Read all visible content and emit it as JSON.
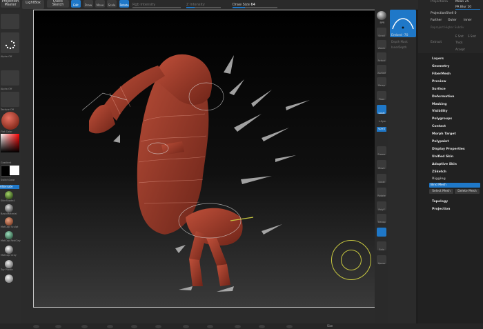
{
  "top_bar": {
    "projection_master": "Projection Master",
    "lightbox": "LightBox",
    "quicksketch": "Quick Sketch",
    "edit": "Edit",
    "draw": "Draw",
    "move": "Move",
    "scale": "Scale",
    "rotate": "Rotate",
    "rgb_intensity": "Rgb Intensity",
    "z_intensity": "Z Intensity",
    "draw_size_label": "Draw Size",
    "draw_size_value": "64",
    "mrgb_label": "Mrgb",
    "rgb_label": "Rgb",
    "m_label": "M",
    "zadd_label": "Zadd",
    "zsub_label": "Zsub",
    "zcut_label": "Zcut"
  },
  "right_top": {
    "projection_label": "ProjectionS",
    "mean_label": "Mean",
    "mean_value": "25",
    "pa_blur_label": "PA Blur",
    "pa_blur_value": "10",
    "projection_shell_label": "ProjectionShell",
    "projection_shell_value": "0",
    "further": "Further",
    "outer": "Outer",
    "inner": "Inner",
    "reproject_higher_subdiv": "Reproject Higher Subdiv",
    "extract": "Extract",
    "e_smt": "E Smt",
    "s_smt": "S Smt",
    "thick": "Thick",
    "accept": "Accept",
    "embed_label": "Embed",
    "embed_value": "-70",
    "depth_mask": "Depth Mask",
    "inner_depth": "InnerDepth"
  },
  "menu": {
    "items_top": [
      "Layers",
      "Geometry",
      "FiberMesh",
      "Preview",
      "Surface",
      "Deformation",
      "Masking",
      "Visibility",
      "Polygroups",
      "Contact",
      "Morph Target",
      "Polypaint",
      "Display Properties",
      "Unified Skin",
      "Adaptive Skin",
      "ZSketch"
    ],
    "rigging": "Rigging",
    "bind_mesh": "Bind Mesh",
    "select_mesh": "Select Mesh",
    "delete_mesh": "Delete Mesh",
    "items_bottom": [
      "Topology",
      "Projection"
    ]
  },
  "shelf": {
    "bpr": "BPR",
    "spix": "SPix",
    "scroll": "Scroll",
    "zoom": "Zoom",
    "actual": "Actual",
    "aahalf": "AAHalf",
    "persp": "Persp",
    "floor": "Floor",
    "local": "Local",
    "lsym": "L.Sym",
    "xyz": "%XYZ",
    "frame": "Frame",
    "move": "Move",
    "scale": "Scale",
    "rotate": "Rotate",
    "polyf": "PolyF",
    "transp": "Transp",
    "solo": "Solo",
    "xpose": "Xpose",
    "backface": "BackfaceMas"
  },
  "left_panel": {
    "alpha_off": "Alpha Off",
    "texture_off": "Texture Off",
    "flat_color": "Flat Color",
    "gradient": "Gradient",
    "switch_color": "SwitchColor",
    "alternate": "Alternate",
    "materials": [
      "SkinShade4",
      "BasicMaterial",
      "MatCap Sculpt",
      "MatCap RedClay",
      "MatCap Gray",
      "Toy Plastic"
    ]
  },
  "bottom": {
    "size_label": "Size"
  },
  "colors": {
    "accent": "#1f78c8",
    "model_red": "#9b3a2a",
    "gizmo_yellow": "#c8c840"
  }
}
